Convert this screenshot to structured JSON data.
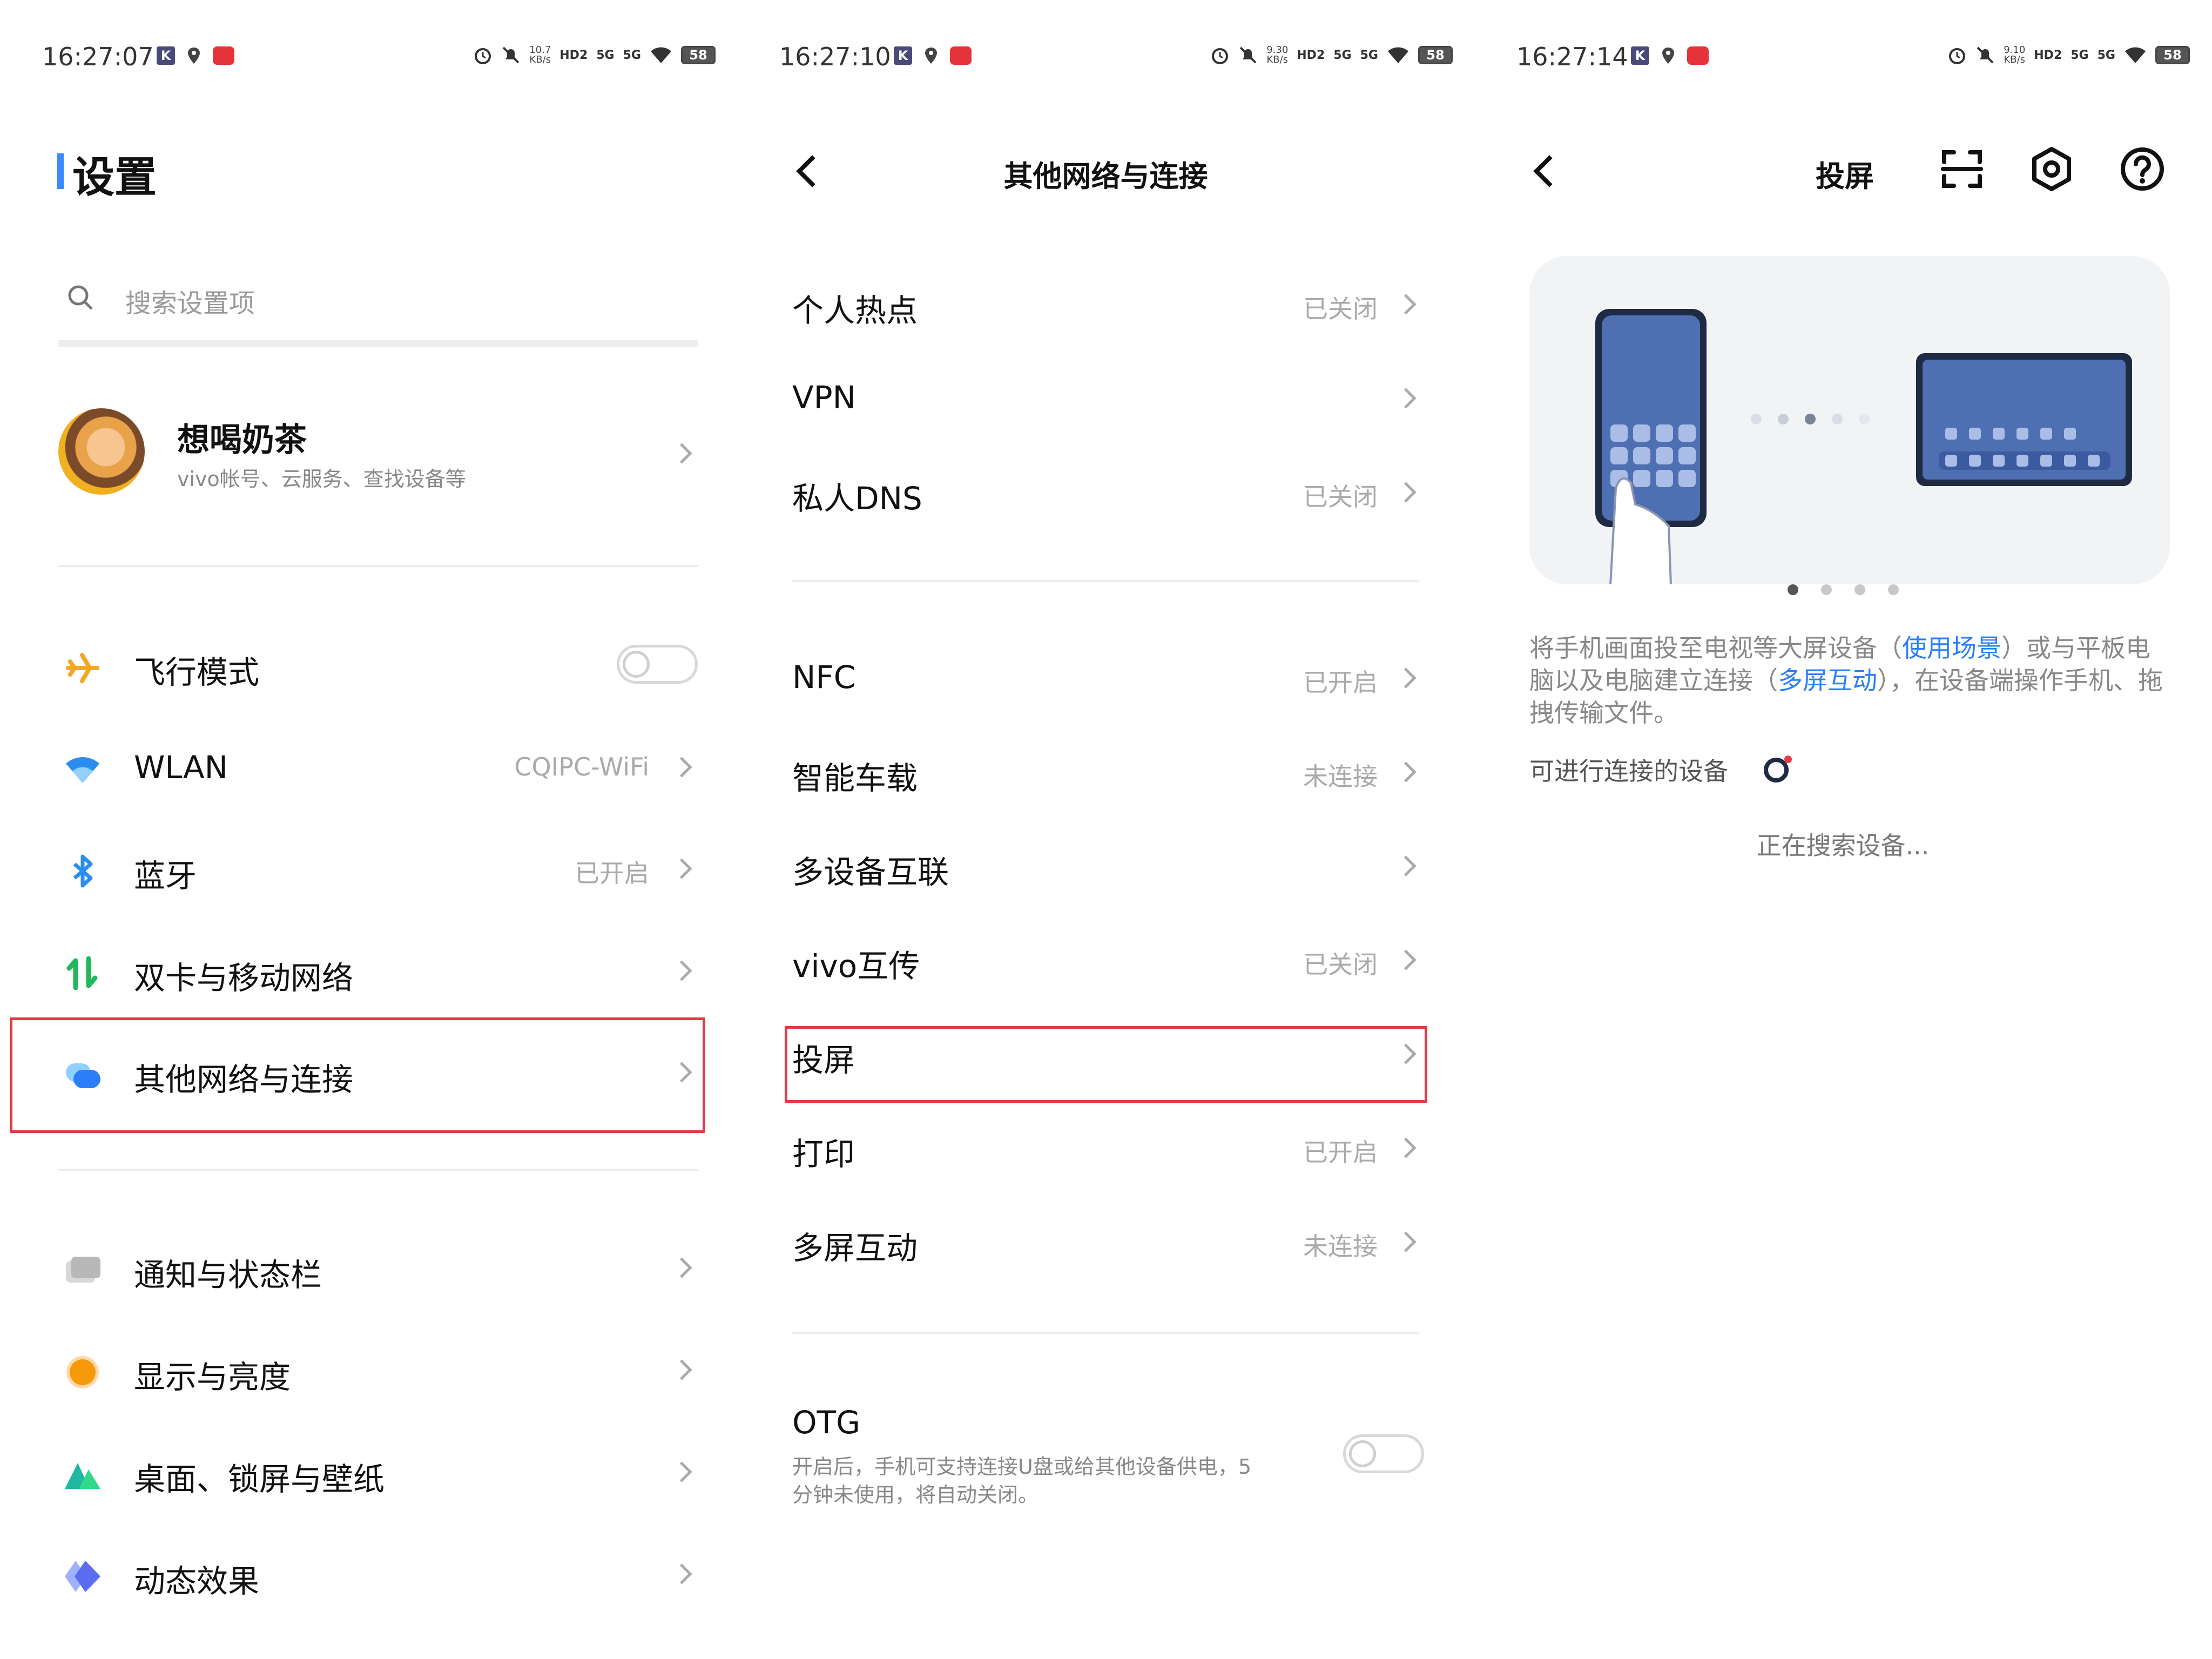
{
  "status_bars": [
    {
      "time": "16:27:07",
      "speed_top": "10.7",
      "speed_bottom": "KB/s",
      "hd": "HD2",
      "net1": "5G",
      "net2": "5G",
      "battery": "58"
    },
    {
      "time": "16:27:10",
      "speed_top": "9.30",
      "speed_bottom": "KB/s",
      "hd": "HD2",
      "net1": "5G",
      "net2": "5G",
      "battery": "58"
    },
    {
      "time": "16:27:14",
      "speed_top": "9.10",
      "speed_bottom": "KB/s",
      "hd": "HD2",
      "net1": "5G",
      "net2": "5G",
      "battery": "58"
    }
  ],
  "status_k": "K",
  "settings": {
    "title": "设置",
    "search_placeholder": "搜索设置项",
    "profile": {
      "name": "想喝奶茶",
      "subtitle": "vivo帐号、云服务、查找设备等"
    },
    "items": [
      {
        "label": "飞行模式",
        "value": "",
        "icon": "airplane-icon",
        "toggle": true
      },
      {
        "label": "WLAN",
        "value": "CQIPC-WiFi",
        "icon": "wifi-icon"
      },
      {
        "label": "蓝牙",
        "value": "已开启",
        "icon": "bluetooth-icon"
      },
      {
        "label": "双卡与移动网络",
        "value": "",
        "icon": "mobile-network-icon"
      },
      {
        "label": "其他网络与连接",
        "value": "",
        "icon": "other-connections-icon"
      },
      {
        "label": "通知与状态栏",
        "value": "",
        "icon": "notification-icon"
      },
      {
        "label": "显示与亮度",
        "value": "",
        "icon": "display-brightness-icon"
      },
      {
        "label": "桌面、锁屏与壁纸",
        "value": "",
        "icon": "wallpaper-icon"
      },
      {
        "label": "动态效果",
        "value": "",
        "icon": "animation-icon"
      }
    ]
  },
  "network": {
    "title": "其他网络与连接",
    "items": [
      {
        "label": "个人热点",
        "value": "已关闭"
      },
      {
        "label": "VPN",
        "value": ""
      },
      {
        "label": "私人DNS",
        "value": "已关闭"
      },
      {
        "label": "NFC",
        "value": "已开启"
      },
      {
        "label": "智能车载",
        "value": "未连接"
      },
      {
        "label": "多设备互联",
        "value": ""
      },
      {
        "label": "vivo互传",
        "value": "已关闭"
      },
      {
        "label": "投屏",
        "value": ""
      },
      {
        "label": "打印",
        "value": "已开启"
      },
      {
        "label": "多屏互动",
        "value": "未连接"
      }
    ],
    "otg": {
      "label": "OTG",
      "description": "开启后，手机可支持连接U盘或给其他设备供电，5分钟未使用，将自动关闭。"
    }
  },
  "cast": {
    "title": "投屏",
    "desc_part1": "将手机画面投至电视等大屏设备（",
    "desc_link1": "使用场景",
    "desc_part2": "）或与平板电脑以及电脑建立连接（",
    "desc_link2": "多屏互动",
    "desc_part3": "），在设备端操作手机、拖拽传输文件。",
    "devices_label": "可进行连接的设备",
    "searching": "正在搜索设备..."
  },
  "colors": {
    "accent": "#3a8bff",
    "link": "#2c7ef8",
    "highlight": "#e23b43"
  }
}
